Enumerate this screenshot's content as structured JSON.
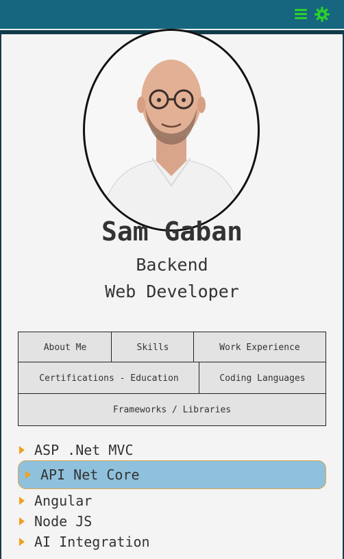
{
  "profile": {
    "name": "Sam Gaban",
    "role_line1": "Backend",
    "role_line2": "Web Developer"
  },
  "tabs": [
    "About Me",
    "Skills",
    "Work Experience",
    "Certifications - Education",
    "Coding Languages",
    "Frameworks / Libraries"
  ],
  "list": [
    "ASP .Net MVC",
    "API Net Core",
    "Angular",
    "Node JS",
    "AI Integration"
  ],
  "selected_item": "API Net Core",
  "colors": {
    "accent": "#2bd12b",
    "topbar": "#17667f",
    "highlight": "#8fc1dc",
    "bullet": "#f0a020"
  },
  "icons": [
    "menu-icon",
    "gear-icon",
    "bullet-arrow-icon"
  ]
}
